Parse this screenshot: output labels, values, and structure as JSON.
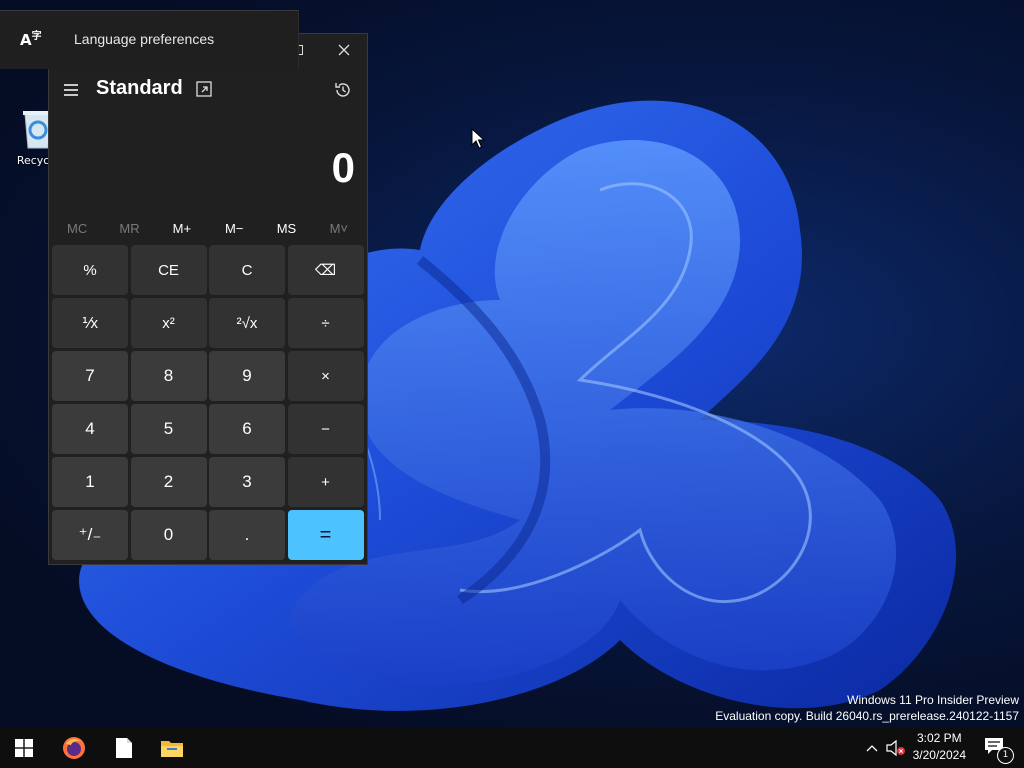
{
  "desktop": {
    "recycle_bin_label": "Recycle",
    "watermark_line1": "Windows 11 Pro Insider Preview",
    "watermark_line2": "Evaluation copy. Build 26040.rs_prerelease.240122-1157"
  },
  "language_flyout": {
    "icon": "language-icon",
    "label": "Language preferences"
  },
  "calculator": {
    "mode": "Standard",
    "display": "0",
    "memory": [
      {
        "label": "MC",
        "enabled": false
      },
      {
        "label": "MR",
        "enabled": false
      },
      {
        "label": "M+",
        "enabled": true
      },
      {
        "label": "M−",
        "enabled": true
      },
      {
        "label": "MS",
        "enabled": true
      },
      {
        "label": "M˅",
        "enabled": false
      }
    ],
    "keys": [
      {
        "label": "%",
        "type": "op",
        "name": "percent-button"
      },
      {
        "label": "CE",
        "type": "op",
        "name": "clear-entry-button"
      },
      {
        "label": "C",
        "type": "op",
        "name": "clear-button"
      },
      {
        "label": "⌫",
        "type": "op",
        "name": "backspace-button"
      },
      {
        "label": "⅟x",
        "type": "op",
        "name": "reciprocal-button"
      },
      {
        "label": "x²",
        "type": "op",
        "name": "square-button"
      },
      {
        "label": "²√x",
        "type": "op",
        "name": "square-root-button"
      },
      {
        "label": "÷",
        "type": "op",
        "name": "divide-button"
      },
      {
        "label": "7",
        "type": "num",
        "name": "digit-7-button"
      },
      {
        "label": "8",
        "type": "num",
        "name": "digit-8-button"
      },
      {
        "label": "9",
        "type": "num",
        "name": "digit-9-button"
      },
      {
        "label": "×",
        "type": "op",
        "name": "multiply-button"
      },
      {
        "label": "4",
        "type": "num",
        "name": "digit-4-button"
      },
      {
        "label": "5",
        "type": "num",
        "name": "digit-5-button"
      },
      {
        "label": "6",
        "type": "num",
        "name": "digit-6-button"
      },
      {
        "label": "−",
        "type": "op",
        "name": "minus-button"
      },
      {
        "label": "1",
        "type": "num",
        "name": "digit-1-button"
      },
      {
        "label": "2",
        "type": "num",
        "name": "digit-2-button"
      },
      {
        "label": "3",
        "type": "num",
        "name": "digit-3-button"
      },
      {
        "label": "+",
        "type": "op",
        "name": "plus-button"
      },
      {
        "label": "⁺/₋",
        "type": "num",
        "name": "negate-button"
      },
      {
        "label": "0",
        "type": "num",
        "name": "digit-0-button"
      },
      {
        "label": ".",
        "type": "num",
        "name": "decimal-button"
      },
      {
        "label": "=",
        "type": "eq",
        "name": "equals-button"
      }
    ]
  },
  "taskbar": {
    "time": "3:02 PM",
    "date": "3/20/2024",
    "notification_count": "1"
  },
  "colors": {
    "accent": "#4cc2ff",
    "calc_bg": "#202020",
    "taskbar_bg": "#0e0e0e"
  }
}
